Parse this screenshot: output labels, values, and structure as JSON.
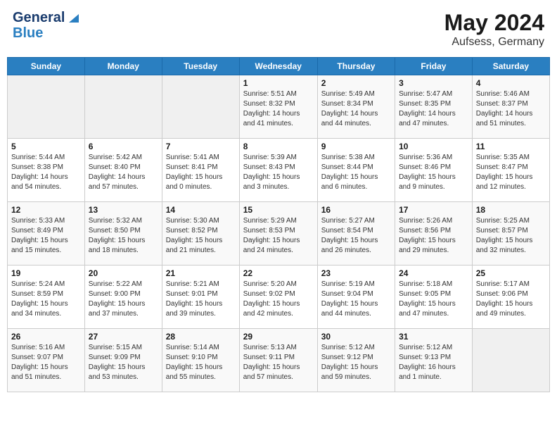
{
  "header": {
    "logo_general": "General",
    "logo_blue": "Blue",
    "title": "May 2024",
    "location": "Aufsess, Germany"
  },
  "days_of_week": [
    "Sunday",
    "Monday",
    "Tuesday",
    "Wednesday",
    "Thursday",
    "Friday",
    "Saturday"
  ],
  "weeks": [
    [
      {
        "day": "",
        "info": ""
      },
      {
        "day": "",
        "info": ""
      },
      {
        "day": "",
        "info": ""
      },
      {
        "day": "1",
        "info": "Sunrise: 5:51 AM\nSunset: 8:32 PM\nDaylight: 14 hours\nand 41 minutes."
      },
      {
        "day": "2",
        "info": "Sunrise: 5:49 AM\nSunset: 8:34 PM\nDaylight: 14 hours\nand 44 minutes."
      },
      {
        "day": "3",
        "info": "Sunrise: 5:47 AM\nSunset: 8:35 PM\nDaylight: 14 hours\nand 47 minutes."
      },
      {
        "day": "4",
        "info": "Sunrise: 5:46 AM\nSunset: 8:37 PM\nDaylight: 14 hours\nand 51 minutes."
      }
    ],
    [
      {
        "day": "5",
        "info": "Sunrise: 5:44 AM\nSunset: 8:38 PM\nDaylight: 14 hours\nand 54 minutes."
      },
      {
        "day": "6",
        "info": "Sunrise: 5:42 AM\nSunset: 8:40 PM\nDaylight: 14 hours\nand 57 minutes."
      },
      {
        "day": "7",
        "info": "Sunrise: 5:41 AM\nSunset: 8:41 PM\nDaylight: 15 hours\nand 0 minutes."
      },
      {
        "day": "8",
        "info": "Sunrise: 5:39 AM\nSunset: 8:43 PM\nDaylight: 15 hours\nand 3 minutes."
      },
      {
        "day": "9",
        "info": "Sunrise: 5:38 AM\nSunset: 8:44 PM\nDaylight: 15 hours\nand 6 minutes."
      },
      {
        "day": "10",
        "info": "Sunrise: 5:36 AM\nSunset: 8:46 PM\nDaylight: 15 hours\nand 9 minutes."
      },
      {
        "day": "11",
        "info": "Sunrise: 5:35 AM\nSunset: 8:47 PM\nDaylight: 15 hours\nand 12 minutes."
      }
    ],
    [
      {
        "day": "12",
        "info": "Sunrise: 5:33 AM\nSunset: 8:49 PM\nDaylight: 15 hours\nand 15 minutes."
      },
      {
        "day": "13",
        "info": "Sunrise: 5:32 AM\nSunset: 8:50 PM\nDaylight: 15 hours\nand 18 minutes."
      },
      {
        "day": "14",
        "info": "Sunrise: 5:30 AM\nSunset: 8:52 PM\nDaylight: 15 hours\nand 21 minutes."
      },
      {
        "day": "15",
        "info": "Sunrise: 5:29 AM\nSunset: 8:53 PM\nDaylight: 15 hours\nand 24 minutes."
      },
      {
        "day": "16",
        "info": "Sunrise: 5:27 AM\nSunset: 8:54 PM\nDaylight: 15 hours\nand 26 minutes."
      },
      {
        "day": "17",
        "info": "Sunrise: 5:26 AM\nSunset: 8:56 PM\nDaylight: 15 hours\nand 29 minutes."
      },
      {
        "day": "18",
        "info": "Sunrise: 5:25 AM\nSunset: 8:57 PM\nDaylight: 15 hours\nand 32 minutes."
      }
    ],
    [
      {
        "day": "19",
        "info": "Sunrise: 5:24 AM\nSunset: 8:59 PM\nDaylight: 15 hours\nand 34 minutes."
      },
      {
        "day": "20",
        "info": "Sunrise: 5:22 AM\nSunset: 9:00 PM\nDaylight: 15 hours\nand 37 minutes."
      },
      {
        "day": "21",
        "info": "Sunrise: 5:21 AM\nSunset: 9:01 PM\nDaylight: 15 hours\nand 39 minutes."
      },
      {
        "day": "22",
        "info": "Sunrise: 5:20 AM\nSunset: 9:02 PM\nDaylight: 15 hours\nand 42 minutes."
      },
      {
        "day": "23",
        "info": "Sunrise: 5:19 AM\nSunset: 9:04 PM\nDaylight: 15 hours\nand 44 minutes."
      },
      {
        "day": "24",
        "info": "Sunrise: 5:18 AM\nSunset: 9:05 PM\nDaylight: 15 hours\nand 47 minutes."
      },
      {
        "day": "25",
        "info": "Sunrise: 5:17 AM\nSunset: 9:06 PM\nDaylight: 15 hours\nand 49 minutes."
      }
    ],
    [
      {
        "day": "26",
        "info": "Sunrise: 5:16 AM\nSunset: 9:07 PM\nDaylight: 15 hours\nand 51 minutes."
      },
      {
        "day": "27",
        "info": "Sunrise: 5:15 AM\nSunset: 9:09 PM\nDaylight: 15 hours\nand 53 minutes."
      },
      {
        "day": "28",
        "info": "Sunrise: 5:14 AM\nSunset: 9:10 PM\nDaylight: 15 hours\nand 55 minutes."
      },
      {
        "day": "29",
        "info": "Sunrise: 5:13 AM\nSunset: 9:11 PM\nDaylight: 15 hours\nand 57 minutes."
      },
      {
        "day": "30",
        "info": "Sunrise: 5:12 AM\nSunset: 9:12 PM\nDaylight: 15 hours\nand 59 minutes."
      },
      {
        "day": "31",
        "info": "Sunrise: 5:12 AM\nSunset: 9:13 PM\nDaylight: 16 hours\nand 1 minute."
      },
      {
        "day": "",
        "info": ""
      }
    ]
  ]
}
